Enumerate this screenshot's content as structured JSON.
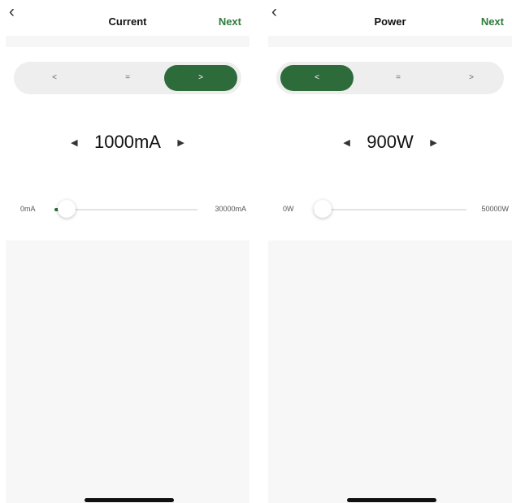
{
  "left": {
    "header": {
      "back_icon": "chevron-left-icon",
      "title": "Current",
      "next_label": "Next"
    },
    "segments": {
      "labels": [
        "<",
        "=",
        ">"
      ],
      "selected_index": 2
    },
    "stepper": {
      "value": "1000mA"
    },
    "slider": {
      "min_label": "0mA",
      "max_label": "30000mA",
      "level_fraction": 0.033
    }
  },
  "right": {
    "header": {
      "back_icon": "chevron-left-icon",
      "title": "Power",
      "next_label": "Next"
    },
    "segments": {
      "labels": [
        "<",
        "=",
        ">"
      ],
      "selected_index": 0
    },
    "stepper": {
      "value": "900W"
    },
    "slider": {
      "min_label": "0W",
      "max_label": "50000W",
      "level_fraction": 0.018
    }
  },
  "colors": {
    "accent": "#2e6b3b",
    "next_text": "#2f7a3a",
    "segment_bg": "#eeeeee"
  }
}
